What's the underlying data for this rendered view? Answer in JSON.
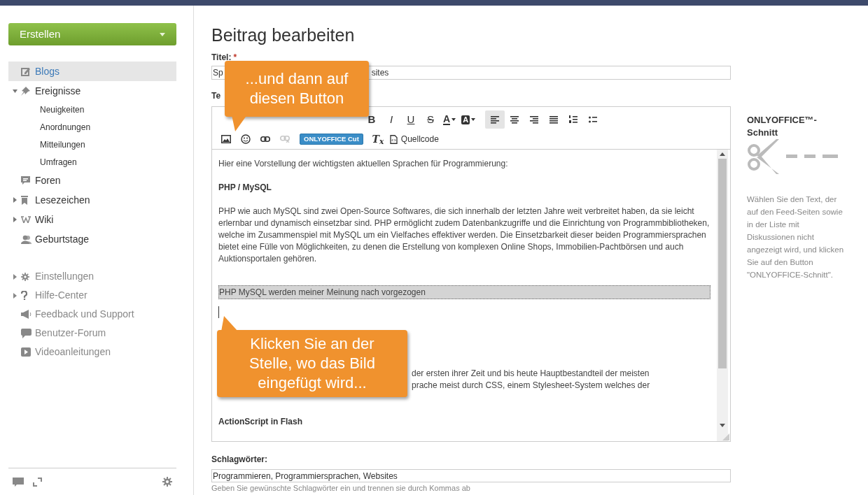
{
  "sidebar": {
    "create_button": "Erstellen",
    "items": [
      {
        "label": "Blogs",
        "selected": true
      },
      {
        "label": "Ereignisse",
        "selected": false,
        "expanded": true,
        "children": [
          {
            "label": "Neuigkeiten"
          },
          {
            "label": "Anordnungen"
          },
          {
            "label": "Mitteilungen"
          },
          {
            "label": "Umfragen"
          }
        ]
      },
      {
        "label": "Foren",
        "selected": false
      },
      {
        "label": "Lesezeichen",
        "selected": false,
        "expanded": false
      },
      {
        "label": "Wiki",
        "selected": false,
        "expanded": false
      },
      {
        "label": "Geburtstage",
        "selected": false
      }
    ],
    "help_items": [
      {
        "label": "Einstellungen",
        "expanded": false
      },
      {
        "label": "Hilfe-Center",
        "expanded": false
      },
      {
        "label": "Feedback und Support"
      },
      {
        "label": "Benutzer-Forum"
      },
      {
        "label": "Videoanleitungen"
      }
    ]
  },
  "page_title": "Beitrag bearbeiten",
  "title_field": {
    "label": "Titel:",
    "required_mark": "*",
    "value_start": "Sp",
    "value_end": "sites"
  },
  "text_label": "Te",
  "toolbar": {
    "format_buttons": [
      "B",
      "I",
      "U",
      "S"
    ],
    "color_buttons": [
      "A",
      "A"
    ],
    "alignment": [
      {
        "selected": true
      },
      {
        "selected": false
      },
      {
        "selected": false
      },
      {
        "selected": false
      }
    ],
    "insert_buttons": [
      {
        "disabled": false
      },
      {
        "disabled": false
      },
      {
        "disabled": false
      },
      {
        "disabled": true
      }
    ],
    "cut_button": "ONLYOFFICE Cut",
    "clear_format_button": "T$_{x}$",
    "source_button": "Quellcode"
  },
  "editor": {
    "blocks": [
      {
        "kind": "paragraph",
        "text": "Hier eine Vorstellung der wichtigsten aktuellen Sprachen für Programmierung:"
      },
      {
        "kind": "heading",
        "text": "PHP / MySQL"
      },
      {
        "kind": "paragraph",
        "text": "PHP wie auch MySQL sind zwei Open-Source Softwares, die sich innerhalb der letzten Jahre weit verbreitet haben, da sie leicht erlernbar und dynamisch einsetzbar sind. PHP ermöglicht zudem Datenbankzugriffe und die Einrichtung von Programmbibliotheken, welche im Zusammenspiel mit MySQL um ein Vielfaches effektiver werden. Die Einsetzbarkeit dieser beiden Programmiersprachen bietet eine Fülle von Möglichkeiten, zu denen die Erstellung von komplexen Online Shops, Immobilien-Pachtbörsen und auch Auktionsportalen gehören."
      },
      {
        "kind": "highlight",
        "text": "PHP MySQL werden meiner Meinung nach vorgezogen"
      },
      {
        "kind": "cursor"
      },
      {
        "kind": "partial",
        "lines": [
          "der ersten ihrer Zeit und bis heute Hauptbestandteil der meisten",
          "prache meist durch CSS, einem Stylesheet-System welches der"
        ]
      },
      {
        "kind": "heading",
        "text": "ActionScript in Flash"
      }
    ]
  },
  "callouts": [
    {
      "text": "...und dann auf diesen Button"
    },
    {
      "text": "Klicken Sie an der Stelle, wo das Bild eingefügt wird..."
    }
  ],
  "tags_field": {
    "label": "Schlagwörter:",
    "value": "Programmieren, Programmiersprachen, Websites",
    "hint": "Geben Sie gewünschte Schlagwörter ein und trennen sie durch Kommas ab"
  },
  "side_panel": {
    "title": "ONLYOFFICE™-Schnitt",
    "description": "Wählen Sie den Text, der auf den Feed-Seiten sowie in der Liste mit Diskussionen nicht angezeigt wird, und klicken Sie auf den Button \"ONLYOFFICE-Schnitt\"."
  }
}
